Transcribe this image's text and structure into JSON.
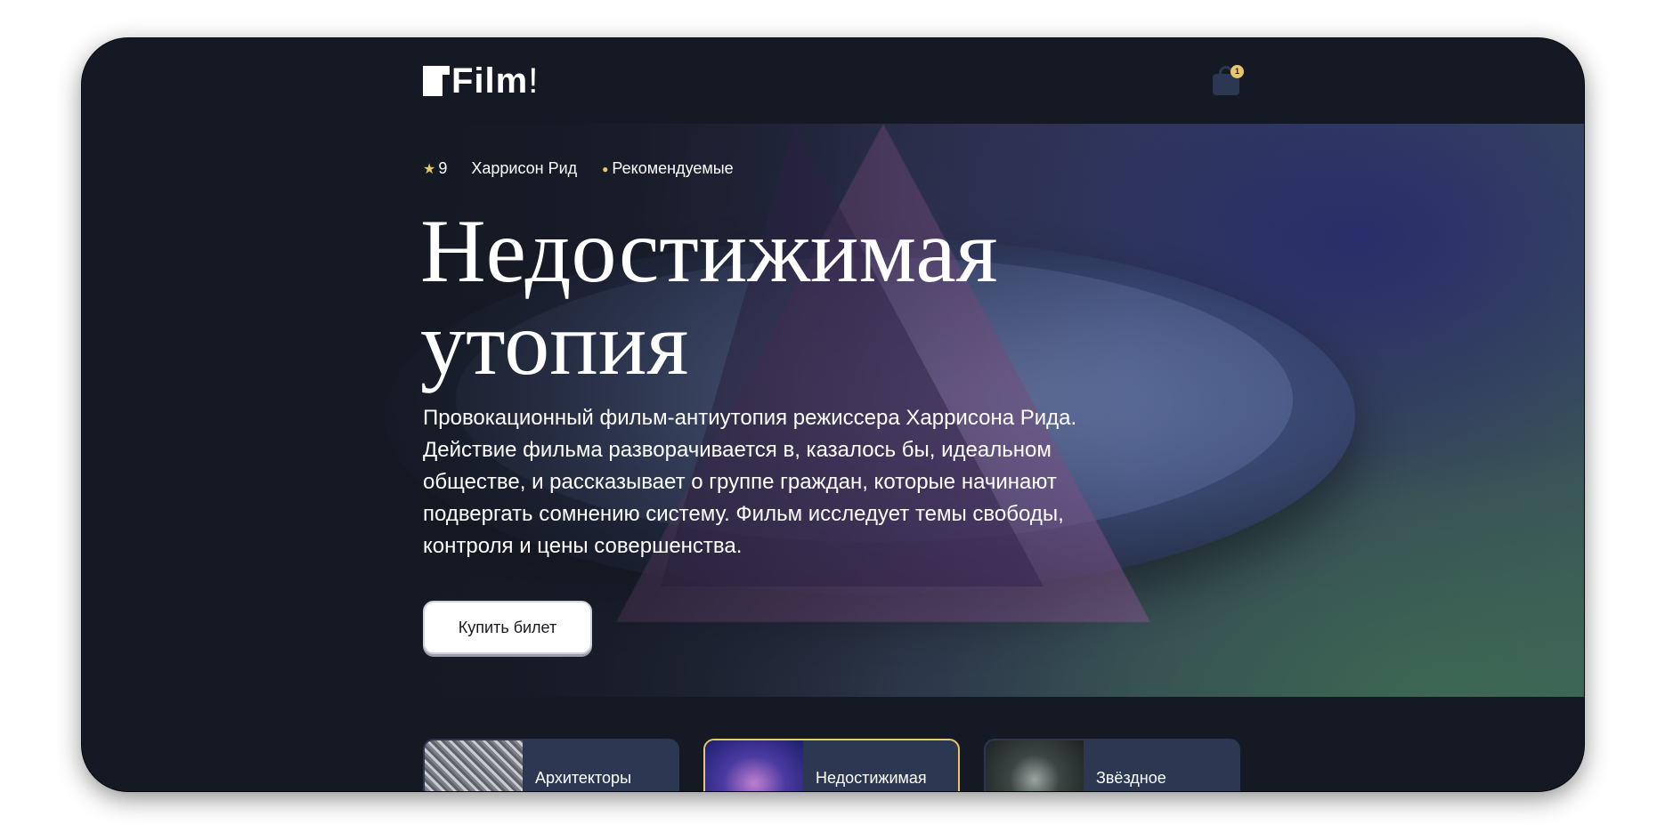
{
  "app": {
    "logo_text": "Film",
    "logo_suffix": "!"
  },
  "cart": {
    "count": "1",
    "icon": "shopping-bag-icon"
  },
  "hero": {
    "rating": "9",
    "director": "Харрисон Рид",
    "tag": "Рекомендуемые",
    "title_line1": "Недостижимая",
    "title_line2": "утопия",
    "description": "Провокационный фильм-антиутопия режиссера Харрисона Рида. Действие фильма разворачивается в, казалось бы, идеальном обществе, и рассказывает о группе граждан, которые начинают подвергать сомнению систему. Фильм исследует темы свободы, контроля и цены совершенства.",
    "buy_label": "Купить билет"
  },
  "cards": [
    {
      "title": "Архитекторы",
      "active": false
    },
    {
      "title": "Недостижимая",
      "active": true
    },
    {
      "title": "Звёздное",
      "active": false
    }
  ],
  "colors": {
    "background": "#151923",
    "accent": "#e8c66a",
    "card": "#2c3752"
  }
}
